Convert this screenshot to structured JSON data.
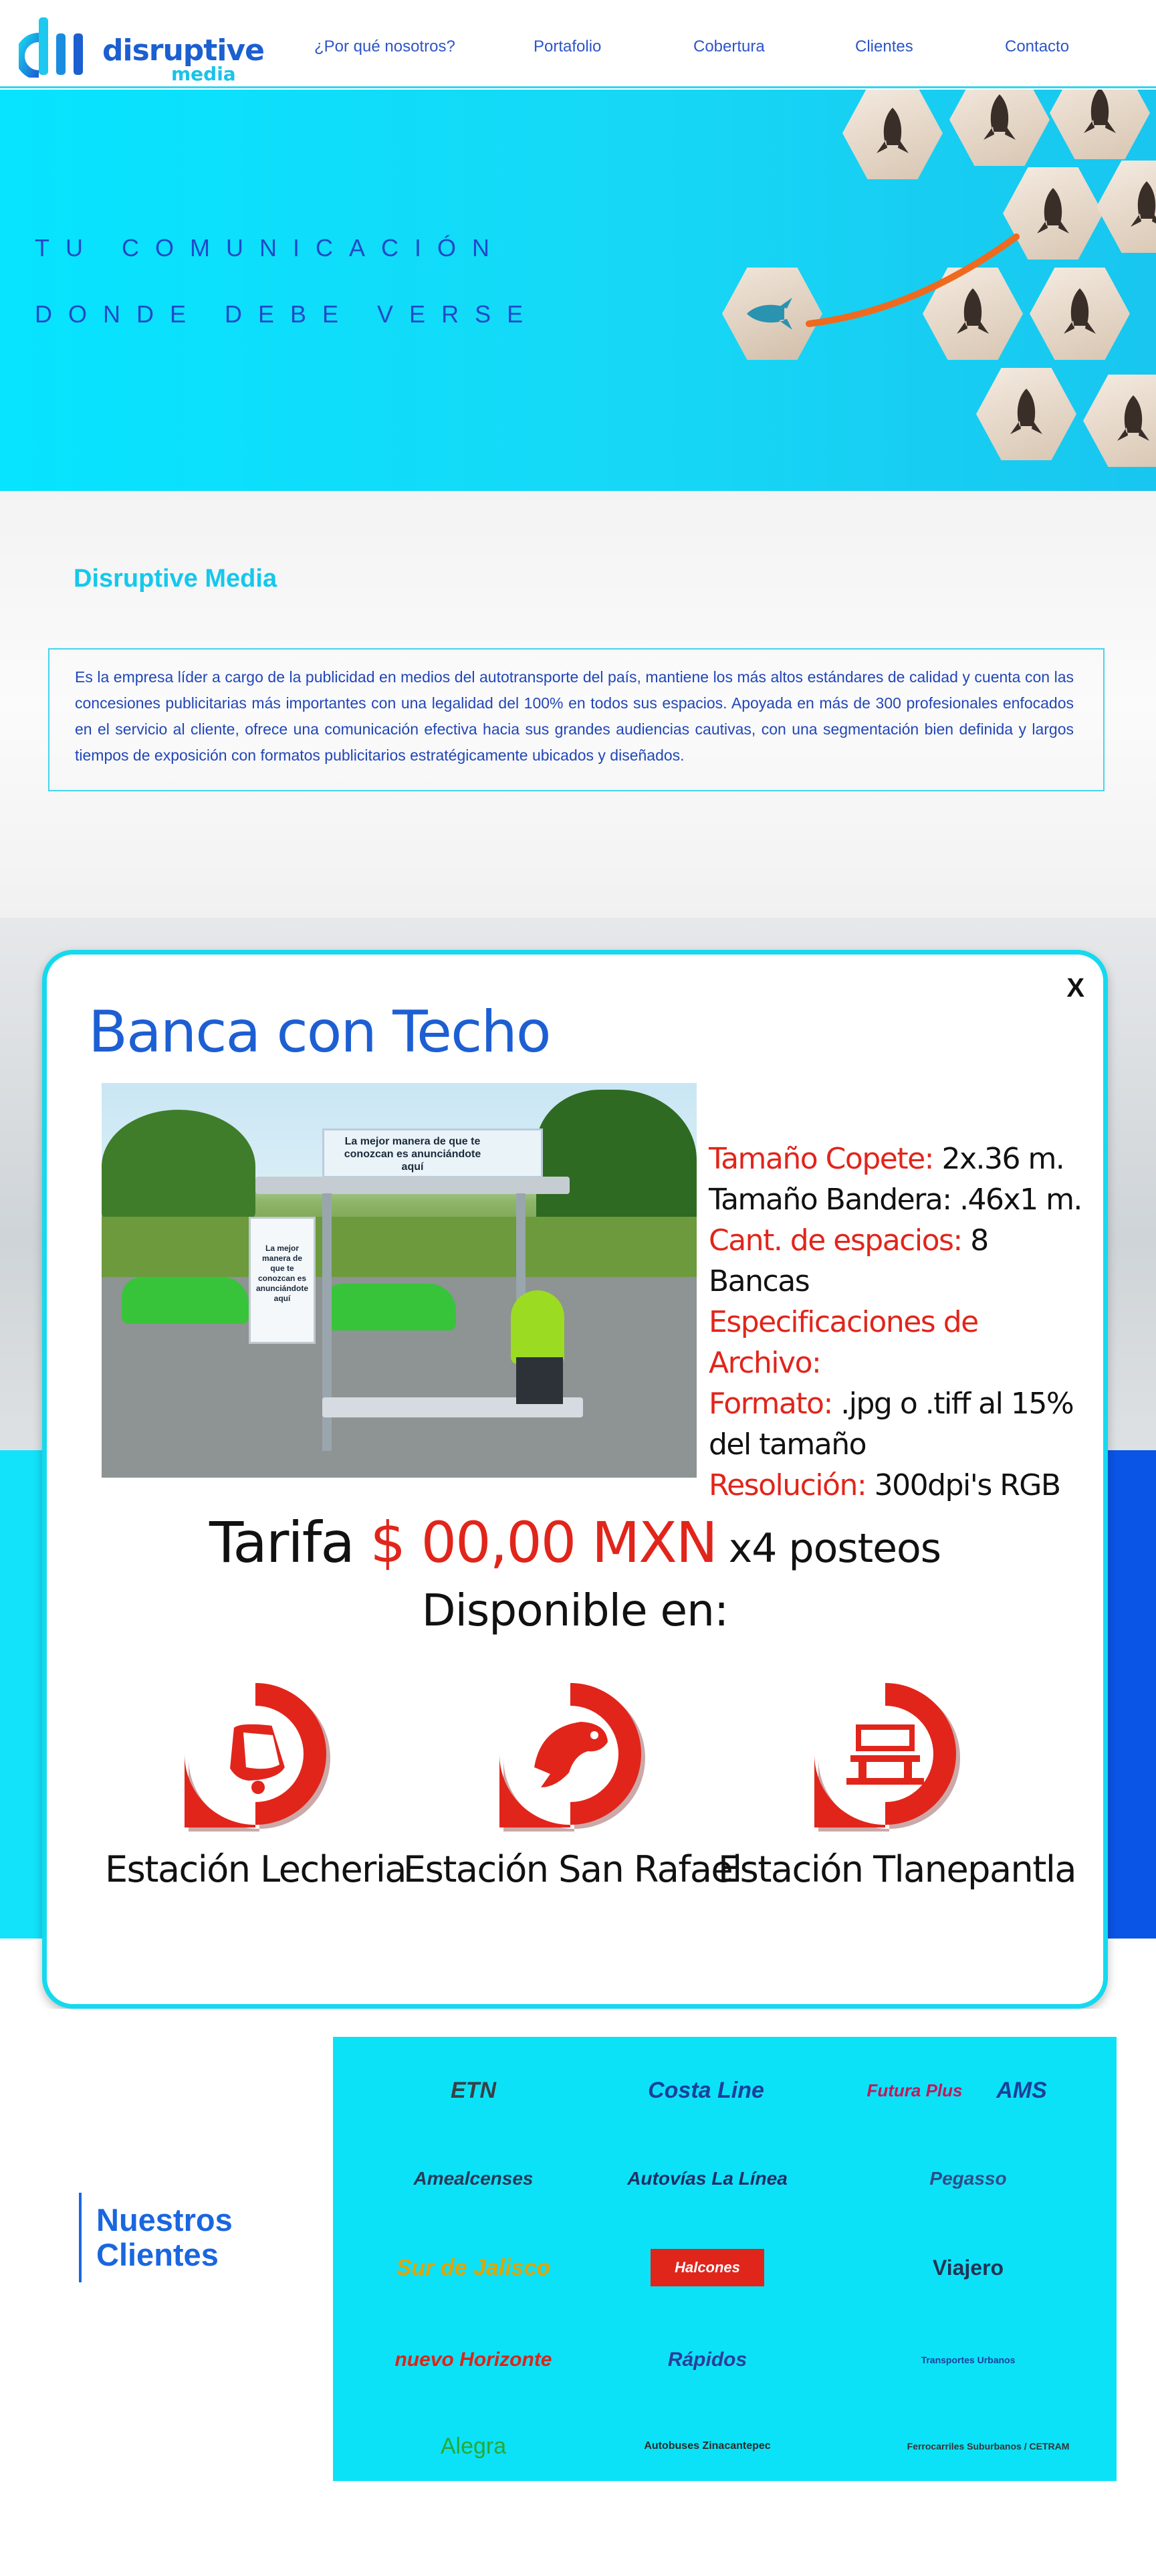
{
  "header": {
    "brand": "disruptive",
    "brand_sub": "media",
    "nav": [
      "¿Por qué nosotros?",
      "Portafolio",
      "Cobertura",
      "Clientes",
      "Contacto"
    ]
  },
  "hero": {
    "line1": "TU COMUNICACIÓN",
    "line2": "DONDE DEBE VERSE"
  },
  "about": {
    "title": "Disruptive Media",
    "text": "Es la empresa líder a cargo de la publicidad en medios del  autotransporte del país, mantiene los más altos estándares de calidad y cuenta con las concesiones publicitarias más importantes  con una legalidad del 100% en todos sus espacios. Apoyada en más de 300 profesionales enfocados en el servicio al cliente, ofrece una comunicación efectiva hacia sus grandes audiencias cautivas, con una segmentación bien definida y largos tiempos de exposición con formatos publicitarios estratégicamente ubicados y diseñados."
  },
  "modal": {
    "close": "X",
    "title": "Banca con Techo",
    "photo": {
      "billboard_text": "La mejor manera de que te conozcan es anunciándote aquí",
      "panel_text": "La mejor manera de que te conozcan es anunciándote aquí"
    },
    "specs": [
      {
        "key": "Tamaño Copete:",
        "value": " 2x.36 m."
      },
      {
        "key": "",
        "value": "Tamaño Bandera: .46x1 m."
      },
      {
        "key": "Cant. de espacios:",
        "value": " 8 Bancas"
      },
      {
        "key": "Especificaciones de Archivo:",
        "value": ""
      },
      {
        "key": "Formato:",
        "value": " .jpg o .tiff al 15% del tamaño"
      },
      {
        "key": "Resolución:",
        "value": " 300dpi's RGB"
      }
    ],
    "tarifa_label": "Tarifa ",
    "price": "$ 00,00 MXN",
    "price_suffix": " x4 posteos",
    "available_label": "Disponible en:",
    "stations": [
      {
        "label": "Estación Lecheria",
        "icon": "bell-icon"
      },
      {
        "label": "Estación San Rafael",
        "icon": "fish-icon"
      },
      {
        "label": "Estación Tlanepantla",
        "icon": "factory-icon"
      }
    ]
  },
  "clients": {
    "title_line1": "Nuestros",
    "title_line2": "Clientes",
    "logos": [
      "ETN",
      "Costa Line",
      "Futura Plus",
      "AMS",
      "Amealcenses",
      "Autovías La Línea",
      "Pegasso",
      "Sur de Jalisco",
      "Halcones",
      "Viajero",
      "nuevo Horizonte",
      "Rápidos",
      "Transportes Urbanos",
      "Alegra",
      "Autobuses Zinacantepec",
      "Ferrocarriles Suburbanos / CETRAM"
    ]
  },
  "colors": {
    "cyan": "#12e3fb",
    "brand_blue": "#1d5fd3",
    "accent_red": "#e1251b"
  }
}
